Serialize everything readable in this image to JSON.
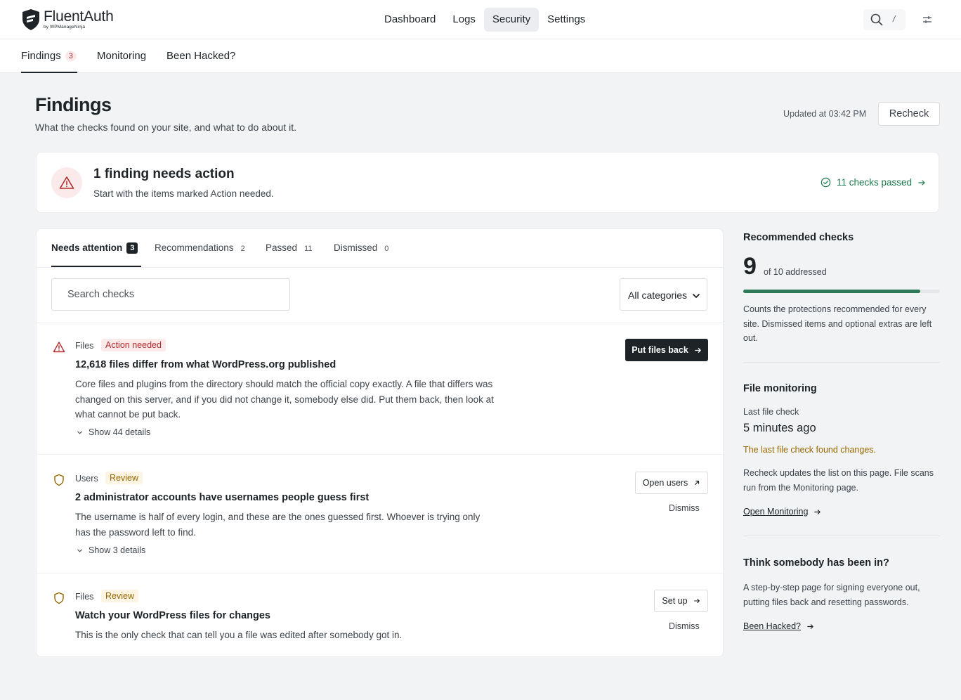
{
  "app": {
    "brand_name": "FluentAuth",
    "brand_sub": "by WPManageNinja"
  },
  "main_nav": [
    {
      "label": "Dashboard",
      "active": false
    },
    {
      "label": "Logs",
      "active": false
    },
    {
      "label": "Security",
      "active": true
    },
    {
      "label": "Settings",
      "active": false
    }
  ],
  "top_tools": {
    "search_icon": "search-icon",
    "shortcut": "/",
    "settings_icon": "sliders-icon"
  },
  "sub_nav": {
    "findings_label": "Findings",
    "findings_count": "3",
    "monitoring_label": "Monitoring",
    "hacked_label": "Been Hacked?"
  },
  "header": {
    "title": "Findings",
    "subtitle": "What the checks found on your site, and what to do about it.",
    "updated": "Updated at 03:42 PM",
    "recheck_label": "Recheck"
  },
  "summary": {
    "title": "1 finding needs action",
    "subtitle": "Start with the items marked Action needed.",
    "passed_link": "11 checks passed",
    "colors": {
      "danger": "#b32d2e",
      "success": "#1f7a4d"
    }
  },
  "tabs": [
    {
      "label": "Needs attention",
      "count": "3",
      "active": true
    },
    {
      "label": "Recommendations",
      "count": "2",
      "active": false
    },
    {
      "label": "Passed",
      "count": "11",
      "active": false
    },
    {
      "label": "Dismissed",
      "count": "0",
      "active": false
    }
  ],
  "filters": {
    "search_placeholder": "Search checks",
    "category_selected": "All categories"
  },
  "findings": [
    {
      "icon": "warning-triangle-icon",
      "category": "Files",
      "badge": "Action needed",
      "title": "12,618 files differ from what WordPress.org published",
      "description": "Core files and plugins from the directory should match the official copy exactly. A file that differs was changed on this server, and if you did not change it, somebody else did. Put them back, then look at what cannot be put back.",
      "details": "Show 44 details",
      "action": "Put files back"
    },
    {
      "icon": "shield-icon",
      "category": "Users",
      "badge": "Review",
      "title": "2 administrator accounts have usernames people guess first",
      "description": "The username is half of every login, and these are the ones guessed first. Whoever is trying only has the password left to find.",
      "details": "Show 3 details",
      "action": "Open users",
      "dismiss": "Dismiss"
    },
    {
      "icon": "shield-icon",
      "category": "Files",
      "badge": "Review",
      "title": "Watch your WordPress files for changes",
      "description": "This is the only check that can tell you a file was edited after somebody got in.",
      "action": "Set up",
      "dismiss": "Dismiss"
    }
  ],
  "sidebar": {
    "recommended": {
      "title": "Recommended checks",
      "addressed": "9",
      "of_text": "of 10 addressed",
      "progress_fraction": 0.9,
      "note": "Counts the protections recommended for every site. Dismissed items and optional extras are left out."
    },
    "monitoring": {
      "title": "File monitoring",
      "last_label": "Last file check",
      "last_value": "5 minutes ago",
      "warning": "The last file check found changes.",
      "note": "Recheck updates the list on this page. File scans run from the Monitoring page.",
      "link": "Open Monitoring"
    },
    "hacked": {
      "title": "Think somebody has been in?",
      "note": "A step-by-step page for signing everyone out, putting files back and resetting passwords.",
      "link": "Been Hacked?"
    }
  }
}
